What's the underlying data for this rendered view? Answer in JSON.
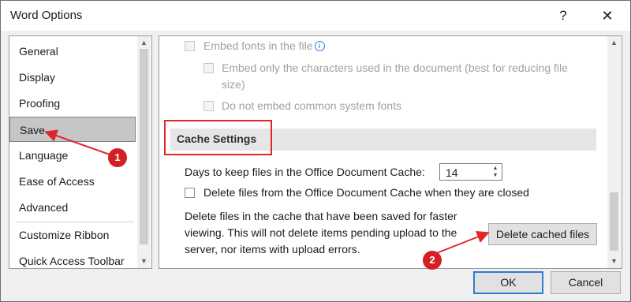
{
  "window": {
    "title": "Word Options",
    "help_label": "?",
    "close_label": "✕"
  },
  "nav": {
    "items": [
      {
        "label": "General"
      },
      {
        "label": "Display"
      },
      {
        "label": "Proofing"
      },
      {
        "label": "Save",
        "selected": true
      },
      {
        "label": "Language"
      },
      {
        "label": "Ease of Access"
      },
      {
        "label": "Advanced"
      },
      {
        "label": "Customize Ribbon"
      },
      {
        "label": "Quick Access Toolbar"
      }
    ]
  },
  "content": {
    "embed_fonts_label": "Embed fonts in the file",
    "embed_only_used_label_line1": "Embed only the characters used in the document (best for reducing file",
    "embed_only_used_label_line2": "size)",
    "do_not_embed_common_label": "Do not embed common system fonts",
    "cache_settings_title": "Cache Settings",
    "days_to_keep_label": "Days to keep files in the Office Document Cache:",
    "days_to_keep_value": "14",
    "delete_on_close_label": "Delete files from the Office Document Cache when they are closed",
    "delete_desc_line1": "Delete files in the cache that have been saved for faster",
    "delete_desc_line2": "viewing. This will not delete items pending upload to the",
    "delete_desc_line3": "server, nor items with upload errors.",
    "delete_cached_button": "Delete cached files"
  },
  "footer": {
    "ok_label": "OK",
    "cancel_label": "Cancel"
  },
  "annotations": {
    "step1": "1",
    "step2": "2",
    "color": "#d31f26"
  },
  "icons": {
    "info": "info-icon",
    "help": "help-icon",
    "close": "close-icon"
  }
}
